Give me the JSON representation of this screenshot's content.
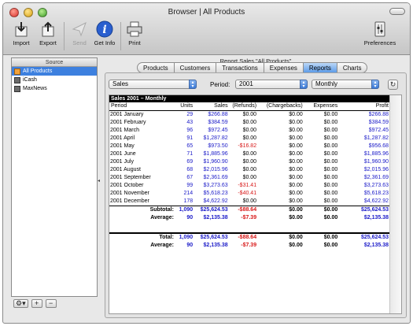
{
  "window": {
    "title": "Browser | All Products"
  },
  "toolbar": {
    "import_label": "Import",
    "export_label": "Export",
    "send_label": "Send",
    "getinfo_label": "Get Info",
    "print_label": "Print",
    "preferences_label": "Preferences"
  },
  "sidebar": {
    "header": "Source",
    "items": [
      {
        "label": "All Products",
        "selected": true,
        "icon": "products-icon"
      },
      {
        "label": "iCash",
        "selected": false,
        "icon": "app-icon"
      },
      {
        "label": "MaxNews",
        "selected": false,
        "icon": "app-icon"
      }
    ]
  },
  "bottom_buttons": {
    "gear": "⚙▾",
    "add": "+",
    "remove": "−"
  },
  "main": {
    "report_title": "Report Sales \"All Products\"",
    "tabs": [
      {
        "label": "Products",
        "active": false
      },
      {
        "label": "Customers",
        "active": false
      },
      {
        "label": "Transactions",
        "active": false
      },
      {
        "label": "Expenses",
        "active": false
      },
      {
        "label": "Reports",
        "active": true
      },
      {
        "label": "Charts",
        "active": false
      }
    ],
    "report_type": "Sales",
    "period_label": "Period:",
    "period_value": "2001",
    "interval_value": "Monthly"
  },
  "report": {
    "heading": "Sales 2001 – Monthly",
    "columns": [
      "Period",
      "Units",
      "Sales",
      "(Refunds)",
      "(Chargebacks)",
      "Expenses",
      "Profit"
    ],
    "rows": [
      [
        "2001 January",
        "29",
        "$266.88",
        "$0.00",
        "$0.00",
        "$0.00",
        "$266.88"
      ],
      [
        "2001 February",
        "43",
        "$384.59",
        "$0.00",
        "$0.00",
        "$0.00",
        "$384.59"
      ],
      [
        "2001 March",
        "96",
        "$972.45",
        "$0.00",
        "$0.00",
        "$0.00",
        "$972.45"
      ],
      [
        "2001 April",
        "91",
        "$1,287.82",
        "$0.00",
        "$0.00",
        "$0.00",
        "$1,287.82"
      ],
      [
        "2001 May",
        "65",
        "$973.50",
        "-$16.82",
        "$0.00",
        "$0.00",
        "$956.68"
      ],
      [
        "2001 June",
        "71",
        "$1,885.96",
        "$0.00",
        "$0.00",
        "$0.00",
        "$1,885.96"
      ],
      [
        "2001 July",
        "69",
        "$1,960.90",
        "$0.00",
        "$0.00",
        "$0.00",
        "$1,960.90"
      ],
      [
        "2001 August",
        "68",
        "$2,015.96",
        "$0.00",
        "$0.00",
        "$0.00",
        "$2,015.96"
      ],
      [
        "2001 September",
        "67",
        "$2,361.69",
        "$0.00",
        "$0.00",
        "$0.00",
        "$2,361.69"
      ],
      [
        "2001 October",
        "99",
        "$3,273.63",
        "-$31.41",
        "$0.00",
        "$0.00",
        "$3,273.63"
      ],
      [
        "2001 November",
        "214",
        "$5,618.23",
        "-$40.41",
        "$0.00",
        "$0.00",
        "$5,618.23"
      ],
      [
        "2001 December",
        "178",
        "$4,622.92",
        "$0.00",
        "$0.00",
        "$0.00",
        "$4,622.92"
      ]
    ],
    "subtotal": {
      "label": "Subtotal:",
      "values": [
        "1,090",
        "$25,624.53",
        "-$88.64",
        "$0.00",
        "$0.00",
        "$25,624.53"
      ]
    },
    "average1": {
      "label": "Average:",
      "values": [
        "90",
        "$2,135.38",
        "-$7.39",
        "$0.00",
        "$0.00",
        "$2,135.38"
      ]
    },
    "total": {
      "label": "Total:",
      "values": [
        "1,090",
        "$25,624.53",
        "-$88.64",
        "$0.00",
        "$0.00",
        "$25,624.53"
      ]
    },
    "average2": {
      "label": "Average:",
      "values": [
        "90",
        "$2,135.38",
        "-$7.39",
        "$0.00",
        "$0.00",
        "$2,135.38"
      ]
    }
  },
  "colors": {
    "selection": "#3d80df",
    "positive": "#1a1ac8",
    "negative": "#d81818",
    "tab_active": "#5d9ce8"
  }
}
